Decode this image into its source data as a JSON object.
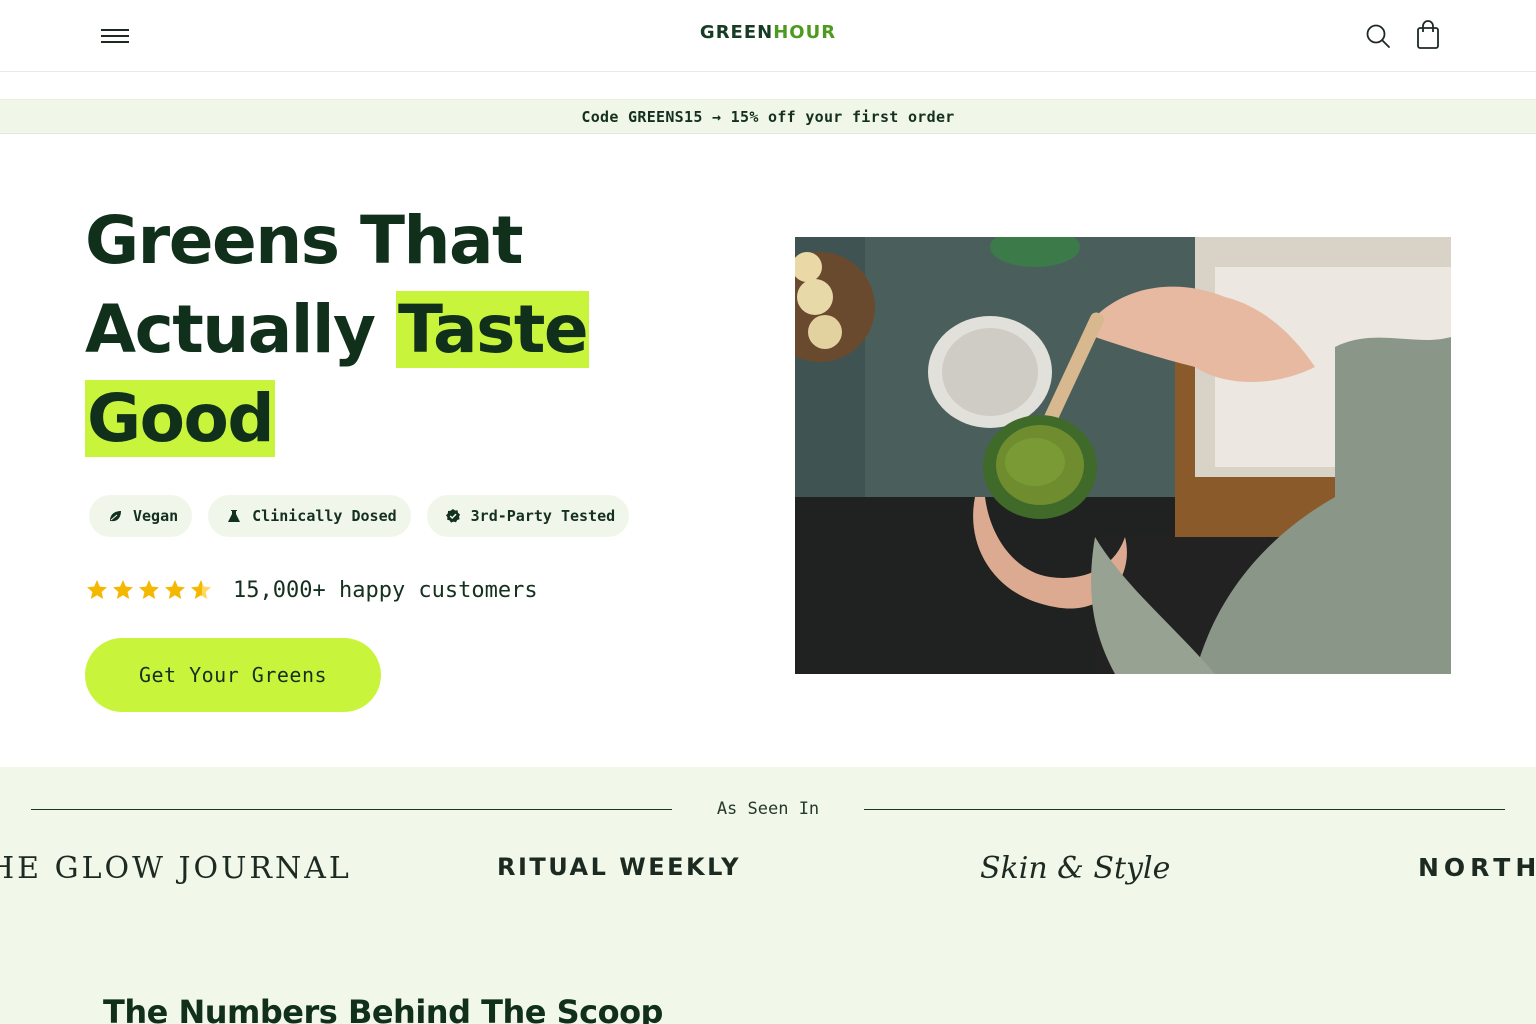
{
  "header": {
    "logo_part1": "GREEN",
    "logo_part2": "HOUR",
    "icons": [
      "menu-icon",
      "search-icon",
      "shopping-bag-icon"
    ]
  },
  "promo": {
    "text": "Code GREENS15 → 15% off your first order"
  },
  "hero": {
    "title_line1": "Greens That",
    "title_line2_plain": "Actually ",
    "title_line2_highlight": "Taste",
    "title_line3_highlight": "Good",
    "badges": [
      {
        "label": "Vegan",
        "icon": "leaf-icon"
      },
      {
        "label": "Clinically Dosed",
        "icon": "flask-icon"
      },
      {
        "label": "3rd-Party Tested",
        "icon": "verified-badge-icon"
      }
    ],
    "rating_stars": 4.5,
    "rating_text": "15,000+ happy customers",
    "cta_label": "Get Your Greens"
  },
  "press": {
    "label": "As Seen In",
    "publications": [
      "HE GLOW JOURNAL",
      "RITUAL WEEKLY",
      "Skin & Style",
      "NORTH"
    ]
  },
  "numbers": {
    "title": "The Numbers Behind The Scoop"
  },
  "colors": {
    "accent": "#c8f53b",
    "dark_green": "#10301c",
    "logo_green": "#4e9a1f",
    "mint_bg": "#f1f7e9",
    "star": "#f5b800"
  }
}
